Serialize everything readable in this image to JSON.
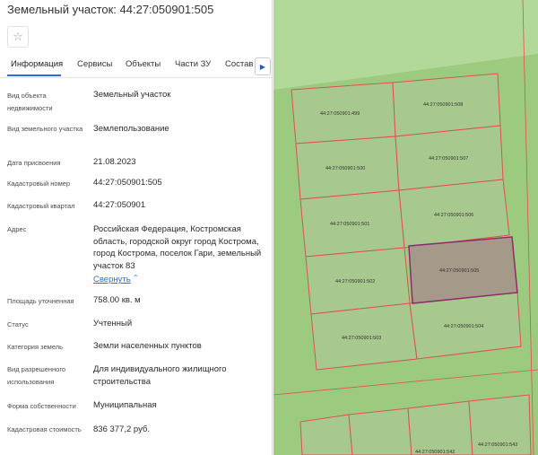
{
  "header": {
    "title": "Земельный участок: 44:27:050901:505"
  },
  "tabs": [
    {
      "label": "Информация"
    },
    {
      "label": "Сервисы"
    },
    {
      "label": "Объекты"
    },
    {
      "label": "Части ЗУ"
    },
    {
      "label": "Состав"
    }
  ],
  "info": {
    "object_type": {
      "label": "Вид объекта недвижимости",
      "value": "Земельный участок"
    },
    "land_type": {
      "label": "Вид земельного участка",
      "value": "Землепользование"
    },
    "assign_date": {
      "label": "Дата присвоения",
      "value": "21.08.2023"
    },
    "cadastral_number": {
      "label": "Кадастровый номер",
      "value": "44:27:050901:505"
    },
    "cadastral_quarter": {
      "label": "Кадастровый квартал",
      "value": "44:27:050901"
    },
    "address": {
      "label": "Адрес",
      "value": "Российская Федерация, Костромская область, городской округ город Кострома, город Кострома, поселок Гари, земельный участок 83",
      "collapse": "Свернуть"
    },
    "area": {
      "label": "Площадь уточненная",
      "value": "758.00 кв. м"
    },
    "status": {
      "label": "Статус",
      "value": "Учтенный"
    },
    "category": {
      "label": "Категория земель",
      "value": "Земли населенных пунктов"
    },
    "permitted_use": {
      "label": "Вид разрешенного использования",
      "value": "Для индивидуального жилищного строительства"
    },
    "ownership": {
      "label": "Форма собственности",
      "value": "Муниципальная"
    },
    "cadastral_value": {
      "label": "Кадастровая стоимость",
      "value": "836 377,2 руб."
    }
  },
  "map": {
    "colors": {
      "background": "#9ccb80",
      "panel": "#ffffff",
      "parcel_fill": "#a8c98e",
      "boundary": "#e05050",
      "selected_fill": "#a59a8a",
      "selected_border": "#8e2a6a"
    },
    "parcels": [
      {
        "label": "44:27:050901:499"
      },
      {
        "label": "44:27:050901:508"
      },
      {
        "label": "44:27:050901:500"
      },
      {
        "label": "44:27:050901:507"
      },
      {
        "label": "44:27:050901:501"
      },
      {
        "label": "44:27:050901:506"
      },
      {
        "label": "44:27:050901:502"
      },
      {
        "label": "44:27:050901:505"
      },
      {
        "label": "44:27:050901:503"
      },
      {
        "label": "44:27:050901:504"
      },
      {
        "label": "44:27:050901:542"
      },
      {
        "label": "44:27:050901:543"
      }
    ]
  },
  "icons": {
    "favorite": "star-icon",
    "tabs_next": "chevron-right-icon",
    "collapse": "chevron-up-icon"
  }
}
